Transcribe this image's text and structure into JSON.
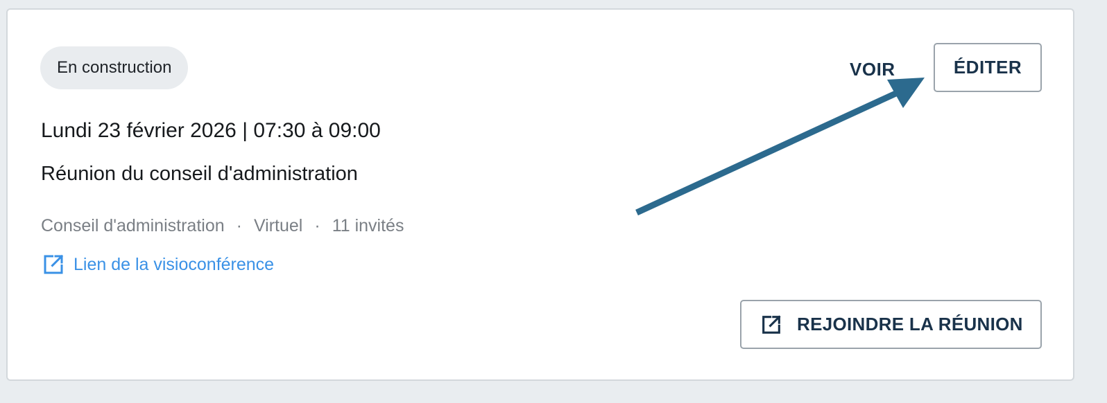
{
  "card": {
    "status_badge": "En construction",
    "date_line": "Lundi 23 février 2026 | 07:30 à 09:00",
    "title": "Réunion du conseil d'administration",
    "meta": {
      "committee": "Conseil d'administration",
      "separator": "·",
      "location": "Virtuel",
      "invitees": "11 invités"
    },
    "video_link": {
      "label": "Lien de la visioconférence",
      "icon": "external-link-icon"
    },
    "actions": {
      "view_label": "VOIR",
      "edit_label": "ÉDITER",
      "join_label": "REJOINDRE LA RÉUNION",
      "join_icon": "external-link-icon"
    }
  },
  "annotation": {
    "icon": "pointer-arrow-icon",
    "color": "#2c6a8e"
  },
  "colors": {
    "link": "#3a91e6",
    "button_text": "#19324a",
    "badge_bg": "#e9ecef",
    "page_bg": "#e9edf0"
  }
}
